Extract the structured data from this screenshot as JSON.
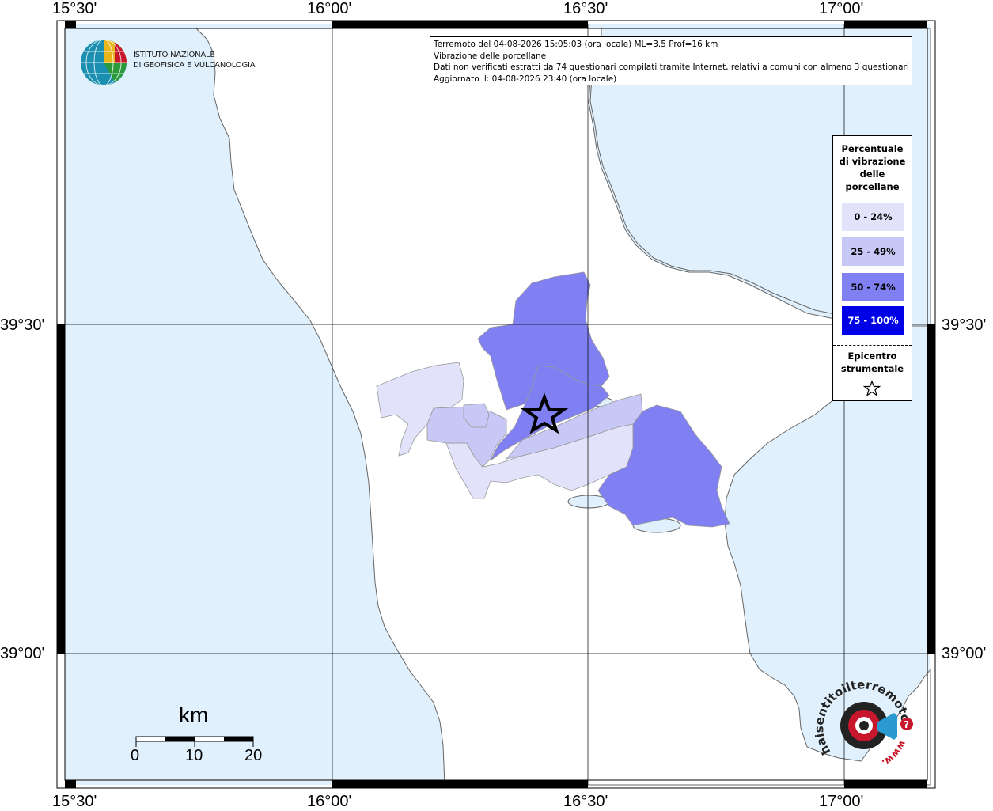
{
  "axes": {
    "longitude_labels": [
      "15°30'",
      "16°00'",
      "16°30'",
      "17°00'"
    ],
    "latitude_labels": [
      "39°30'",
      "39°00'"
    ]
  },
  "info": {
    "line1": "Terremoto del 04-08-2026 15:05:03 (ora locale) ML=3.5 Prof=16 km",
    "line2": "Vibrazione delle porcellane",
    "line3": "Dati non verificati estratti da 74 questionari compilati tramite Internet, relativi a comuni con almeno 3 questionari.",
    "line4": "Aggiornato il: 04-08-2026 23:40 (ora locale)"
  },
  "logo": {
    "line1": "ISTITUTO NAZIONALE",
    "line2": "DI GEOFISICA E VULCANOLOGIA"
  },
  "legend": {
    "title_lines": [
      "Percentuale",
      "di vibrazione",
      "delle",
      "porcellane"
    ],
    "classes": [
      {
        "label": "0 - 24%",
        "color": "#e2e2fa",
        "text_color": "#000000"
      },
      {
        "label": "25 - 49%",
        "color": "#c8c8f6",
        "text_color": "#000000"
      },
      {
        "label": "50 - 74%",
        "color": "#8080f2",
        "text_color": "#000000"
      },
      {
        "label": "75 - 100%",
        "color": "#0000e6",
        "text_color": "#ffffff"
      }
    ],
    "epicenter_lines": [
      "Epicentro",
      "strumentale"
    ]
  },
  "scale": {
    "unit": "km",
    "ticks": [
      "0",
      "10",
      "20"
    ]
  },
  "hai_logo": {
    "text": "haisentitoilterremoto.it",
    "www": "www."
  },
  "colors": {
    "sea": "#e0f0fc",
    "land": "#ffffff",
    "class_0_24": "#e2e2fa",
    "class_25_49": "#c8c8f6",
    "class_50_74": "#8080f2",
    "class_75_100": "#0000e6"
  }
}
